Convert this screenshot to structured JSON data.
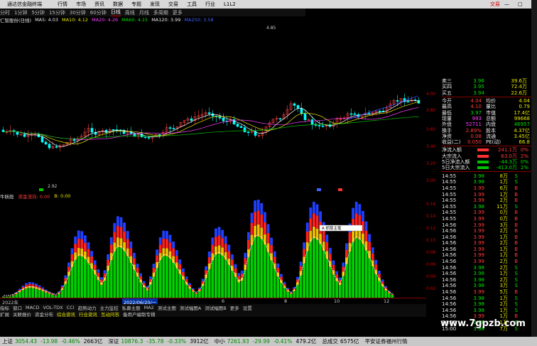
{
  "titlebar": {
    "app_name": "通达信金融终端",
    "menus": [
      "行情",
      "市场",
      "资讯",
      "数据",
      "专题",
      "发现",
      "交易",
      "工具",
      "行业",
      "L1L2"
    ],
    "brand": "交易",
    "min": "—",
    "max": "□",
    "close": "✕"
  },
  "periods": [
    "分时",
    "1分钟",
    "5分钟",
    "15分钟",
    "30分钟",
    "60分钟",
    "日线",
    "周线",
    "月线",
    "多周期",
    "更多"
  ],
  "periods_active": "日线",
  "main_header": {
    "stock": "仁智股份(日线)",
    "ma5": "MA5: 4.03",
    "ma10": "MA10: 4.12",
    "ma20": "MA20: 4.26",
    "ma60": "MA60: 4.15",
    "ma120": "MA120: 3.99",
    "ma250": "MA250: 3.58"
  },
  "chart_labels": {
    "high": "4.85",
    "low": "2.92"
  },
  "price_axis": [
    "4.00",
    "3.80",
    "3.60",
    "3.40",
    "3.20",
    "3.00"
  ],
  "indicator_header": {
    "name": "牛妖段",
    "label1": "资金流向: 0.00",
    "label2": "B: 0.00"
  },
  "ind_axis": [
    "0.16",
    "0.14",
    "0.12",
    "0.10",
    "0.08",
    "0.06",
    "0.04",
    "0.02"
  ],
  "date_bar": {
    "d1": "2022年",
    "d2": "2022/06/20/一",
    "ticks": [
      "6",
      "8",
      "10",
      "12"
    ]
  },
  "tabs1": [
    "指标",
    "窗口",
    "MACD",
    "VOL-TDX",
    "CCI",
    "趋势动力",
    "主力监控",
    "私募主题",
    "MA2",
    "测试主图",
    "测试幅图A",
    "测试幅图B",
    "更多",
    "设置"
  ],
  "tabs2": [
    "扩展",
    "关联报价",
    "资金分布",
    "综合资讯",
    "行业资讯",
    "互动问答",
    "备用户编制专辑"
  ],
  "quote_panel": {
    "ask3": {
      "label": "卖三",
      "price": "3.96",
      "vol": "39.6万"
    },
    "ask4": {
      "label": "买四",
      "price": "3.95",
      "vol": "72.4万"
    },
    "ask5": {
      "label": "买五",
      "price": "3.94",
      "vol": "22.6万"
    },
    "stats": [
      {
        "l1": "今开",
        "v1": "4.04",
        "l2": "均价",
        "v2": "4.04"
      },
      {
        "l1": "最高",
        "v1": "4.10",
        "l2": "量比",
        "v2": "0.79"
      },
      {
        "l1": "最低",
        "v1": "3.97",
        "l2": "市值",
        "v2": "17.4亿"
      },
      {
        "l1": "现量",
        "v1": "993",
        "l2": "总额",
        "v2": "99668"
      },
      {
        "l1": "外盘",
        "v1": "52711",
        "l2": "内盘",
        "v2": "46957"
      },
      {
        "l1": "换手",
        "v1": "2.89%",
        "l2": "股本",
        "v2": "4.37亿"
      },
      {
        "l1": "净资",
        "v1": "0.08",
        "l2": "流通",
        "v2": "3.45亿"
      },
      {
        "l1": "收益(二)",
        "v1": "0.050",
        "l2": "PE(动)",
        "v2": "66.8"
      }
    ],
    "flows": [
      {
        "label": "净流入额",
        "value": "241.1万",
        "pct": "0%"
      },
      {
        "label": "大宗流入",
        "value": "63.0万",
        "pct": "2%"
      },
      {
        "label": "5日净流入额",
        "value": "-44.3万",
        "pct": "0%"
      },
      {
        "label": "5日大宗流入",
        "value": "-413.0万",
        "pct": "2%"
      }
    ],
    "ticks": [
      {
        "t": "14:55",
        "p": "3.98",
        "v": "8",
        "bs": "S"
      },
      {
        "t": "14:55",
        "p": "3.98",
        "v": "1",
        "bs": "S"
      },
      {
        "t": "14:55",
        "p": "3.99",
        "v": "6",
        "bs": "B"
      },
      {
        "t": "14:55",
        "p": "3.99",
        "v": "1",
        "bs": "B"
      },
      {
        "t": "14:55",
        "p": "3.99",
        "v": "2",
        "bs": "B"
      },
      {
        "t": "14:55",
        "p": "3.98",
        "v": "11",
        "bs": "S"
      },
      {
        "t": "14:55",
        "p": "3.99",
        "v": "0",
        "bs": "B"
      },
      {
        "t": "14:55",
        "p": "3.99",
        "v": "0",
        "bs": "B"
      },
      {
        "t": "14:56",
        "p": "3.99",
        "v": "3",
        "bs": "B"
      },
      {
        "t": "14:56",
        "p": "3.99",
        "v": "2",
        "bs": "B"
      },
      {
        "t": "14:56",
        "p": "3.99",
        "v": "1",
        "bs": "B"
      },
      {
        "t": "14:56",
        "p": "3.99",
        "v": "2",
        "bs": "B"
      },
      {
        "t": "14:56",
        "p": "3.99",
        "v": "1",
        "bs": "B"
      },
      {
        "t": "14:56",
        "p": "3.99",
        "v": "1",
        "bs": "B"
      },
      {
        "t": "14:56",
        "p": "3.99",
        "v": "2",
        "bs": "B"
      },
      {
        "t": "14:56",
        "p": "3.98",
        "v": "2",
        "bs": "S"
      },
      {
        "t": "14:56",
        "p": "3.98",
        "v": "1",
        "bs": "S"
      },
      {
        "t": "14:56",
        "p": "3.98",
        "v": "2",
        "bs": "S"
      },
      {
        "t": "14:56",
        "p": "3.98",
        "v": "3",
        "bs": "S"
      },
      {
        "t": "14:56",
        "p": "3.99",
        "v": "5",
        "bs": "B"
      },
      {
        "t": "14:56",
        "p": "3.98",
        "v": "1",
        "bs": "S"
      },
      {
        "t": "14:56",
        "p": "3.98",
        "v": "2",
        "bs": "S"
      },
      {
        "t": "14:56",
        "p": "3.98",
        "v": "1",
        "bs": "S"
      },
      {
        "t": "14:56",
        "p": "3.99",
        "v": "1",
        "bs": "B"
      },
      {
        "t": "14:56",
        "p": "3.98",
        "v": "1",
        "bs": "S"
      },
      {
        "t": "15:00",
        "p": "3.98",
        "v": "7",
        "bs": "S"
      }
    ],
    "tick_unit": "万"
  },
  "status_bar": {
    "sh_label": "上证",
    "sh_val": "3054.43",
    "sh_chg": "-13.98",
    "sh_pct": "-0.46%",
    "sh_amt": "2663亿",
    "sz_label": "深证",
    "sz_val": "10876.3",
    "sz_chg": "-35.78",
    "sz_pct": "-0.33%",
    "sz_amt": "3912亿",
    "zx_label": "中小",
    "zx_val": "7261.93",
    "zx_chg": "-29.99",
    "zx_pct": "-0.41%",
    "zx_amt": "479.2亿",
    "total_label": "总成交",
    "total_val": "6575亿",
    "broker": "平安证券福州行情"
  },
  "watermark": "www.7gpzb.com",
  "floating_btn": "A 抓取主笔"
}
